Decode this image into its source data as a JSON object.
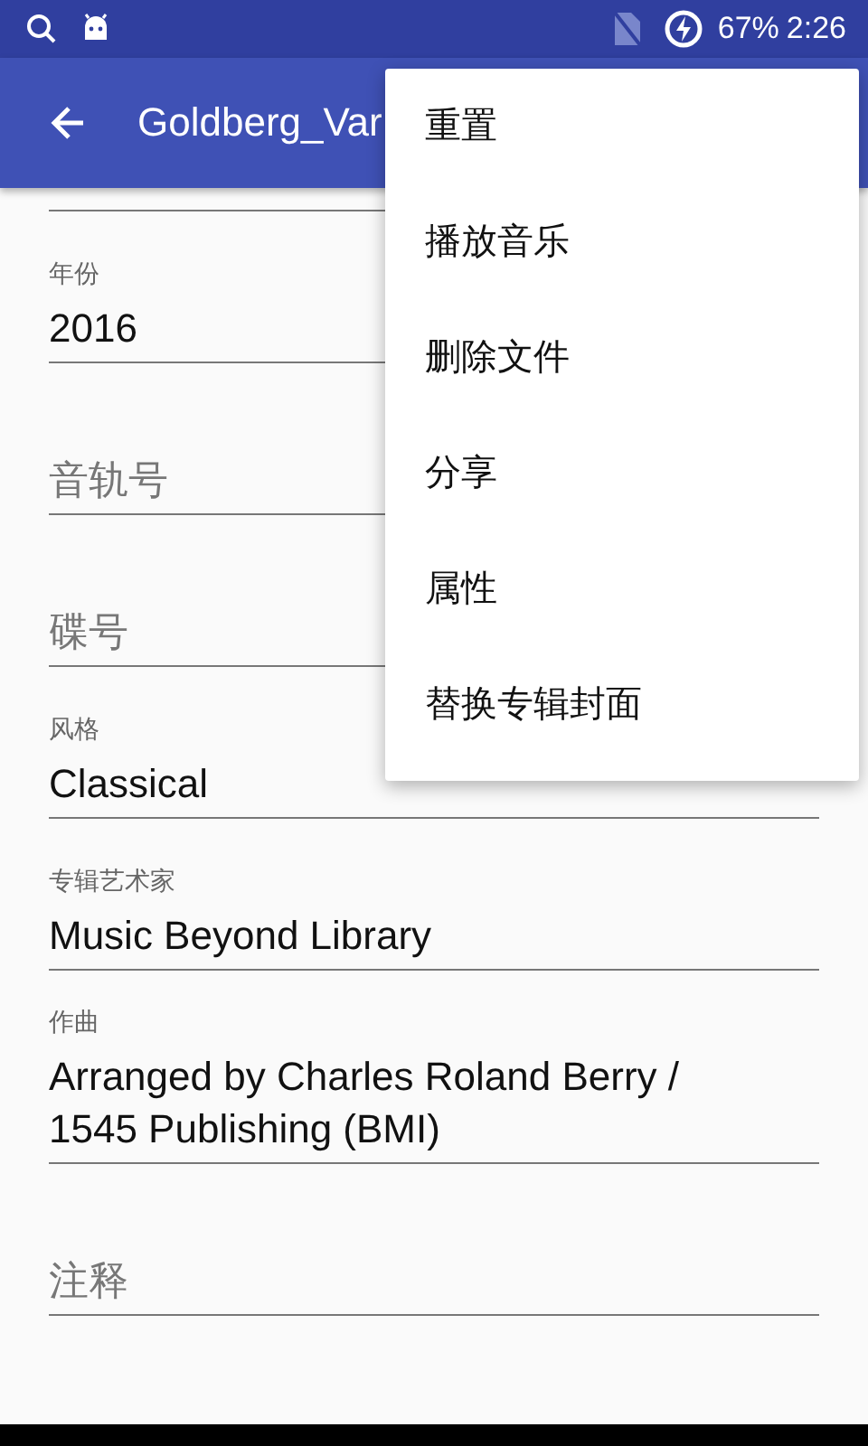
{
  "status_bar": {
    "battery": "67%",
    "time": "2:26"
  },
  "app_bar": {
    "title": "Goldberg_Var"
  },
  "fields": [
    {
      "kind": "filled",
      "label": "年份",
      "value": "2016"
    },
    {
      "kind": "empty",
      "placeholder": "音轨号"
    },
    {
      "kind": "empty",
      "placeholder": "碟号"
    },
    {
      "kind": "filled",
      "label": "风格",
      "value": "Classical"
    },
    {
      "kind": "filled",
      "label": "专辑艺术家",
      "value": "Music Beyond Library"
    },
    {
      "kind": "filled",
      "label": "作曲",
      "value": "Arranged by Charles Roland Berry / 1545 Publishing (BMI)"
    },
    {
      "kind": "empty",
      "placeholder": "注释"
    }
  ],
  "menu": {
    "items": [
      "重置",
      "播放音乐",
      "删除文件",
      "分享",
      "属性",
      "替换专辑封面"
    ]
  }
}
